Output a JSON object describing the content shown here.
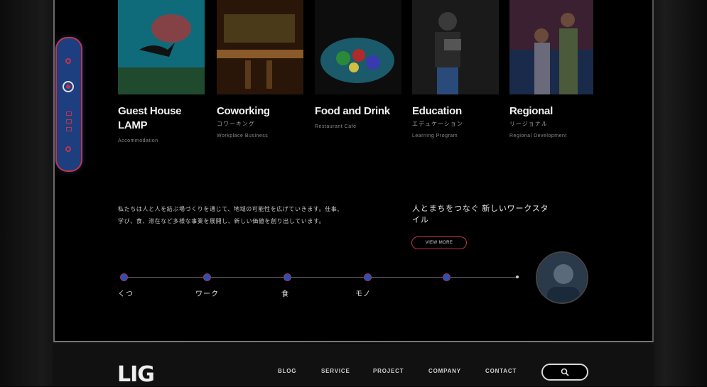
{
  "cards": [
    {
      "title": "Guest House LAMP",
      "subtitle": "",
      "meta": "Accommodation"
    },
    {
      "title": "Coworking",
      "subtitle": "コワーキング",
      "meta": "Workplace Business"
    },
    {
      "title": "Food and Drink",
      "subtitle": "",
      "meta": "Restaurant Café"
    },
    {
      "title": "Education",
      "subtitle": "エデュケーション",
      "meta": "Learning Program"
    },
    {
      "title": "Regional",
      "subtitle": "リージョナル",
      "meta": "Regional Development"
    }
  ],
  "intro_text": "私たちは人と人を結ぶ場づくりを通じて、地域の可能性を広げていきます。仕事、学び、食、滞在など多様な事業を展開し、新しい価値を創り出しています。",
  "feature": {
    "title": "人とまちをつなぐ 新しいワークスタイル",
    "button_label": "VIEW MORE"
  },
  "timeline": [
    "くつ",
    "ワーク",
    "食",
    "モノ"
  ],
  "colors": {
    "accent_blue": "#2353b8",
    "accent_red": "#c2344a"
  },
  "footer": {
    "logo": "LIG",
    "nav": [
      "BLOG",
      "SERVICE",
      "PROJECT",
      "COMPANY",
      "CONTACT"
    ]
  }
}
